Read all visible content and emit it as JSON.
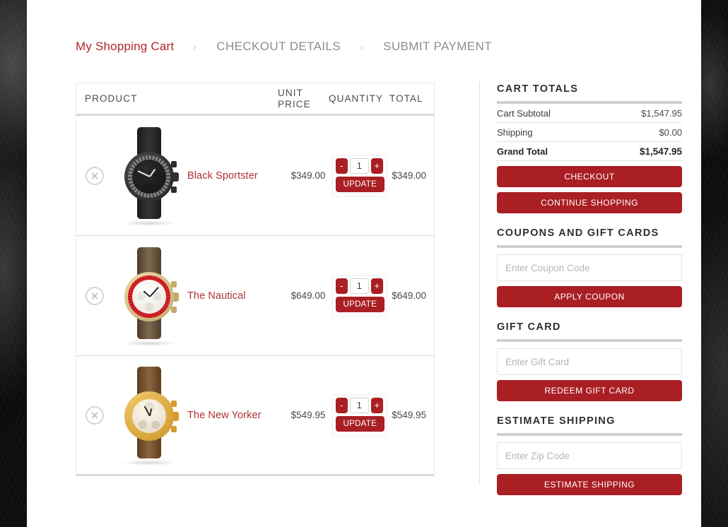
{
  "breadcrumb": {
    "steps": [
      {
        "label": "My Shopping Cart",
        "state": "active"
      },
      {
        "label": "CHECKOUT DETAILS",
        "state": "inactive"
      },
      {
        "label": "SUBMIT PAYMENT",
        "state": "inactive"
      }
    ],
    "separator": "›"
  },
  "cart_table": {
    "columns": {
      "product": "PRODUCT",
      "unit_price_line1": "UNIT",
      "unit_price_line2": "PRICE",
      "quantity": "QUANTITY",
      "total": "TOTAL"
    },
    "rows": [
      {
        "name": "Black Sportster",
        "unit_price": "$349.00",
        "quantity": "1",
        "total": "$349.00",
        "decrement_label": "-",
        "increment_label": "+",
        "update_label": "UPDATE",
        "remove_icon": "close-circle-icon",
        "thumb": {
          "strap": "#2b2b2b",
          "strap2": "#1e1e1e",
          "case": "#3a3a3a",
          "bezel": "#6b6b6b",
          "dial": "#1d1d1d",
          "hands": "#ededed",
          "crown": "#313131"
        }
      },
      {
        "name": "The Nautical",
        "unit_price": "$649.00",
        "quantity": "1",
        "total": "$649.00",
        "decrement_label": "-",
        "increment_label": "+",
        "update_label": "UPDATE",
        "remove_icon": "close-circle-icon",
        "thumb": {
          "strap": "#6d5a43",
          "strap2": "#57462f",
          "case": "#d9bf82",
          "bezel": "#e0262a",
          "dial": "#f5f2ee",
          "hands": "#23211f",
          "crown": "#c6ab6e"
        }
      },
      {
        "name": "The New Yorker",
        "unit_price": "$549.95",
        "quantity": "1",
        "total": "$549.95",
        "decrement_label": "-",
        "increment_label": "+",
        "update_label": "UPDATE",
        "remove_icon": "close-circle-icon",
        "thumb": {
          "strap": "#7b5535",
          "strap2": "#63421f",
          "case": "#e0a83c",
          "bezel": "#edbb55",
          "dial": "#f3ece0",
          "hands": "#3a2d1c",
          "crown": "#d79b2f"
        }
      }
    ]
  },
  "cart_totals": {
    "title": "CART TOTALS",
    "rows": [
      {
        "label": "Cart Subtotal",
        "value": "$1,547.95"
      },
      {
        "label": "Shipping",
        "value": "$0.00"
      },
      {
        "label": "Grand Total",
        "value": "$1,547.95"
      }
    ],
    "checkout_label": "CHECKOUT",
    "continue_label": "CONTINUE SHOPPING"
  },
  "coupons": {
    "title": "COUPONS AND GIFT CARDS",
    "coupon_placeholder": "Enter Coupon Code",
    "coupon_value": "",
    "apply_label": "APPLY COUPON"
  },
  "gift_card": {
    "title": "GIFT CARD",
    "placeholder": "Enter Gift Card",
    "value": "",
    "redeem_label": "REDEEM GIFT CARD"
  },
  "estimate_shipping": {
    "title": "ESTIMATE SHIPPING",
    "placeholder": "Enter Zip Code",
    "value": "",
    "estimate_label": "ESTIMATE SHIPPING"
  },
  "colors": {
    "brand_red": "#a91f24",
    "link_red": "#ab3331",
    "breadcrumb_active": "#b0262b",
    "breadcrumb_inactive": "#8d8d8d",
    "rule_gray": "#cfcfcf"
  }
}
